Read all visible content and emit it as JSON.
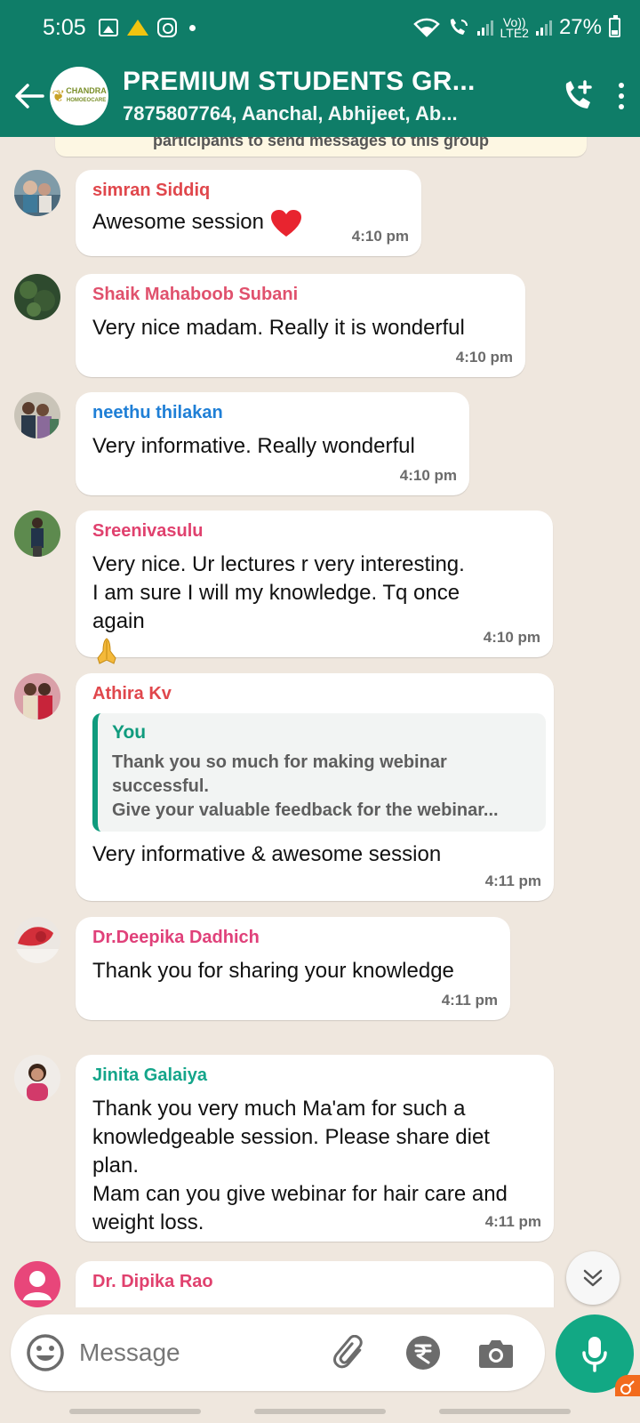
{
  "status_bar": {
    "time": "5:05",
    "network_label_top": "Vo))",
    "network_label_bottom": "LTE2",
    "battery": "27%"
  },
  "header": {
    "title": "PREMIUM STUDENTS GR...",
    "subtitle": "7875807764, Aanchal, Abhijeet, Ab...",
    "avatar_logo_line1": "CHANDRA",
    "avatar_logo_line2": "HOMOEOCARE"
  },
  "system_message": "participants to send messages to this group",
  "messages": [
    {
      "sender": "simran Siddiq",
      "sender_color": "#e0474c",
      "text": "Awesome session",
      "emoji": "heart",
      "time": "4:10 pm"
    },
    {
      "sender": "Shaik Mahaboob Subani",
      "sender_color": "#e0516d",
      "text": "Very nice madam. Really it is wonderful",
      "time": "4:10 pm"
    },
    {
      "sender": "neethu thilakan",
      "sender_color": "#1f7fd6",
      "text": "Very informative. Really wonderful",
      "time": "4:10 pm"
    },
    {
      "sender": "Sreenivasulu",
      "sender_color": "#e0416e",
      "text": "Very nice. Ur lectures r very interesting.\nI am sure I will my knowledge. Tq once again",
      "emoji": "folded-hands",
      "time": "4:10 pm"
    },
    {
      "sender": "Athira Kv",
      "sender_color": "#e0474c",
      "quote": {
        "name": "You",
        "line1": "Thank you so much for making webinar",
        "line2": "successful.",
        "line3": "Give your valuable feedback for the webinar..."
      },
      "text": "Very informative & awesome session",
      "time": "4:11 pm"
    },
    {
      "sender": "Dr.Deepika Dadhich",
      "sender_color": "#e0417a",
      "text": "Thank you for sharing your knowledge",
      "time": "4:11 pm"
    },
    {
      "sender": "Jinita Galaiya",
      "sender_color": "#14a58a",
      "text": "Thank you very much Ma'am for such a knowledgeable session. Please share diet plan.\nMam can you give webinar for hair care and weight loss.",
      "time": "4:11 pm"
    },
    {
      "sender": "Dr. Dipika Rao",
      "sender_color": "#e0416e",
      "text": ""
    }
  ],
  "composer": {
    "placeholder": "Message"
  },
  "colors": {
    "header_bg": "#0f7d68",
    "chat_bg": "#efe7de",
    "mic_bg": "#12a884"
  }
}
